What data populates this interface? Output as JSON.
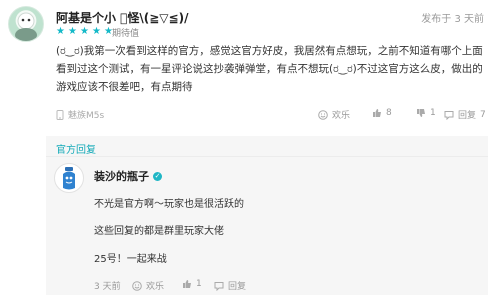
{
  "review": {
    "username": "阿基是个小 ゙怪\\(≧▽≦)/",
    "time": "发布于 3 天前",
    "rating_label": "期待值",
    "stars": 5,
    "text": "(ರ‿ರ)我第一次看到这样的官方，感觉这官方好皮，我居然有点想玩，之前不知道有哪个上面看到过这个测试，有一星评论说这抄袭弹弹堂，有点不想玩(ರ‿ರ)不过这官方这么皮，做出的游戏应该不很差吧，有点期待",
    "device": "魅族M5s",
    "actions": {
      "fun_label": "欢乐",
      "like_count": "8",
      "dislike_count": "1",
      "reply_label": "回复",
      "reply_count": "7"
    }
  },
  "official_reply": {
    "section_label": "官方回复",
    "author": "装沙的瓶子",
    "lines": [
      "不光是官方啊～玩家也是很活跃的",
      "这些回复的都是群里玩家大佬",
      "25号！一起来战"
    ],
    "time": "3 天前",
    "fun_label": "欢乐",
    "like_count": "1",
    "reply_label": "回复"
  },
  "colors": {
    "accent": "#14b9c8",
    "reply_bg": "#f6f6f6"
  },
  "icons": [
    "avatar",
    "star-icon",
    "phone-icon",
    "smile-icon",
    "thumbs-up-icon",
    "thumbs-down-icon",
    "comment-icon",
    "verified-icon"
  ]
}
